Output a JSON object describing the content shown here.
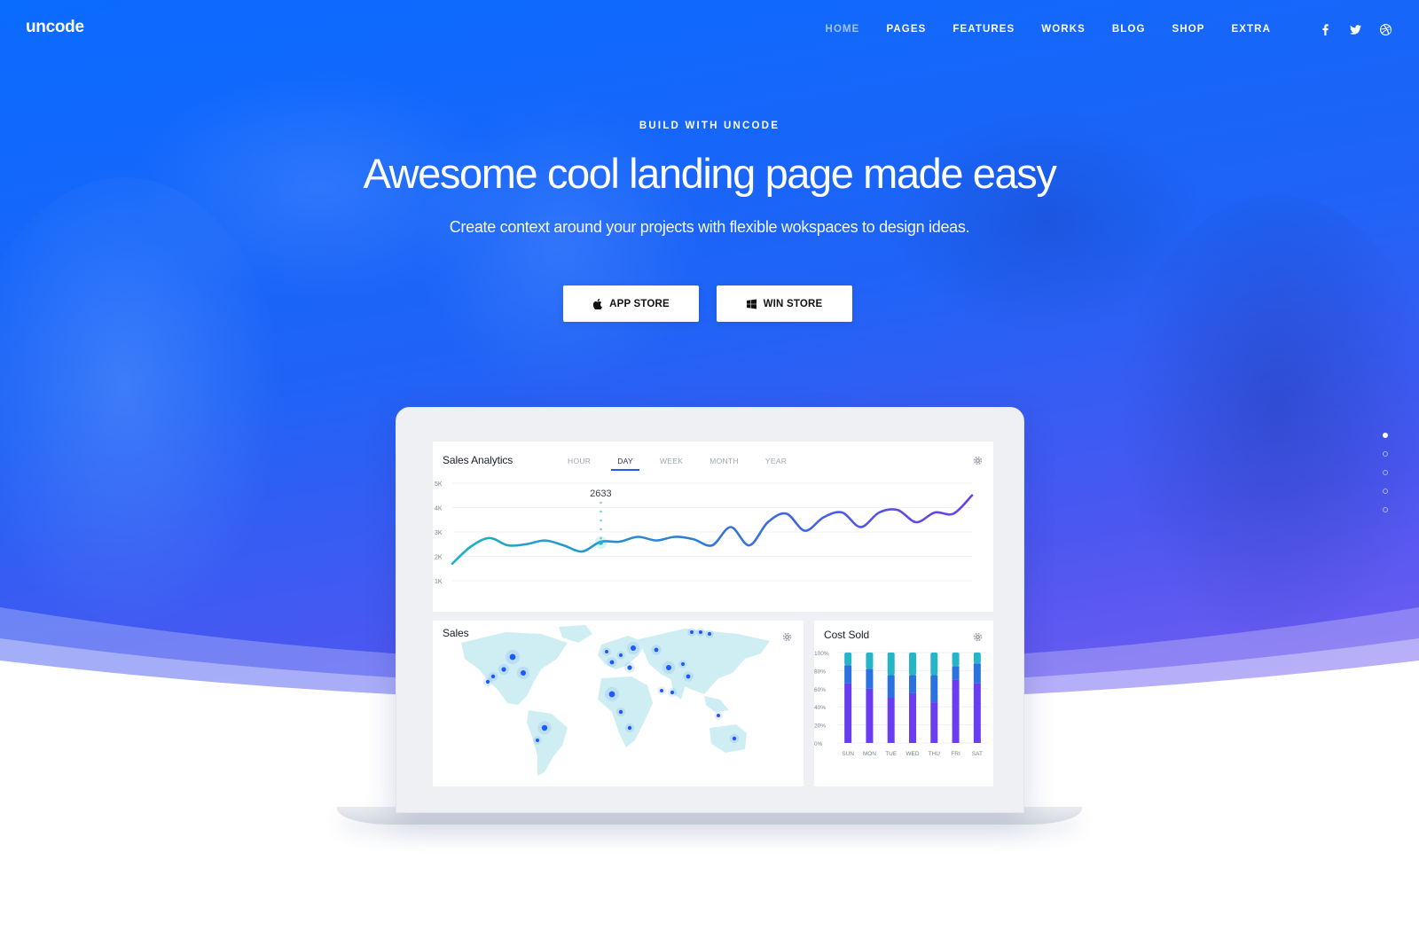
{
  "brand": {
    "logo": "uncode"
  },
  "nav": {
    "items": [
      {
        "label": "HOME",
        "active": true
      },
      {
        "label": "PAGES"
      },
      {
        "label": "FEATURES"
      },
      {
        "label": "WORKS"
      },
      {
        "label": "BLOG"
      },
      {
        "label": "SHOP"
      },
      {
        "label": "EXTRA"
      }
    ],
    "social": [
      "facebook-icon",
      "twitter-icon",
      "dribbble-icon"
    ]
  },
  "hero": {
    "eyebrow": "BUILD WITH UNCODE",
    "headline": "Awesome cool landing page made easy",
    "subline": "Create context around your projects with flexible wokspaces to design ideas.",
    "buttons": [
      {
        "label": "APP STORE",
        "icon": "apple-icon"
      },
      {
        "label": "WIN STORE",
        "icon": "windows-icon"
      }
    ]
  },
  "colors": {
    "primary": "#0a6bff",
    "accent": "#1a5bff",
    "purple": "#6a3df0",
    "teal": "#26b5c7"
  },
  "dashboard": {
    "analytics": {
      "title": "Sales Analytics",
      "tabs": [
        "HOUR",
        "DAY",
        "WEEK",
        "MONTH",
        "YEAR"
      ],
      "active_tab": "DAY"
    },
    "sales": {
      "title": "Sales"
    },
    "cost": {
      "title": "Cost Sold"
    }
  },
  "chart_data": [
    {
      "type": "line",
      "title": "Sales Analytics",
      "yticks": [
        "5K",
        "4K",
        "3K",
        "2K",
        "1K"
      ],
      "ylim": [
        1000,
        5000
      ],
      "values": [
        1700,
        2400,
        2750,
        2450,
        2500,
        2650,
        2450,
        2200,
        2600,
        2600,
        2800,
        2650,
        2800,
        2700,
        2450,
        3200,
        2450,
        3400,
        3750,
        3050,
        3600,
        3800,
        3200,
        3800,
        3900,
        3400,
        3800,
        3750,
        4500
      ],
      "tooltip": {
        "label": "2633",
        "x_index": 8
      },
      "grid": true
    },
    {
      "type": "bar",
      "title": "Cost Sold",
      "categories": [
        "SUN",
        "MON",
        "TUE",
        "WED",
        "THU",
        "FRI",
        "SAT"
      ],
      "yticks": [
        "100%",
        "80%",
        "60%",
        "40%",
        "20%",
        "0%"
      ],
      "ylim": [
        0,
        100
      ],
      "series": [
        {
          "values": [
            66,
            60,
            50,
            55,
            45,
            70,
            66
          ]
        },
        {
          "values": [
            20,
            22,
            25,
            20,
            30,
            15,
            22
          ]
        },
        {
          "values": [
            14,
            18,
            25,
            25,
            25,
            15,
            12
          ]
        }
      ]
    }
  ]
}
